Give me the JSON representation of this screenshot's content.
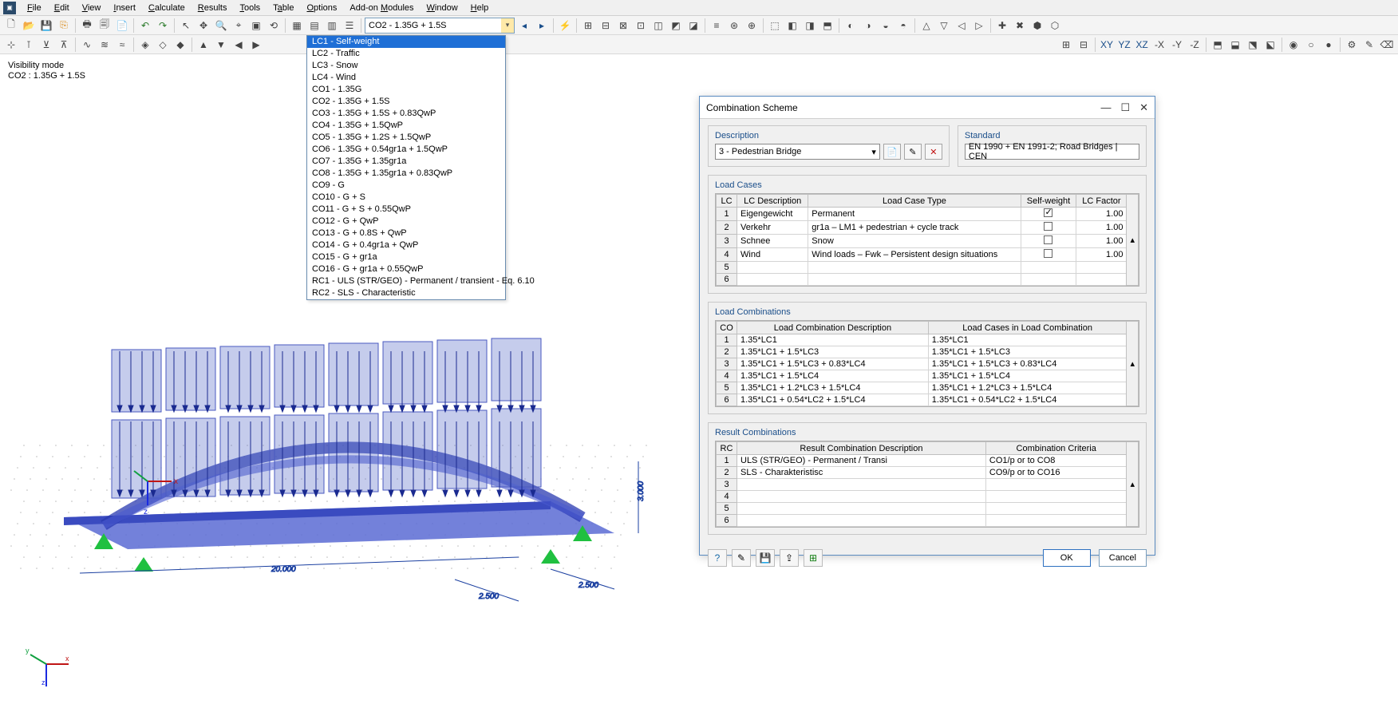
{
  "menu": {
    "items": [
      "File",
      "Edit",
      "View",
      "Insert",
      "Calculate",
      "Results",
      "Tools",
      "Table",
      "Options",
      "Add-on Modules",
      "Window",
      "Help"
    ]
  },
  "combo": {
    "value": "CO2 - 1.35G + 1.5S"
  },
  "dropdown": {
    "selected": 0,
    "options": [
      "LC1 - Self-weight",
      "LC2 - Traffic",
      "LC3 - Snow",
      "LC4 - Wind",
      "CO1 - 1.35G",
      "CO2 - 1.35G + 1.5S",
      "CO3 - 1.35G + 1.5S + 0.83QwP",
      "CO4 - 1.35G + 1.5QwP",
      "CO5 - 1.35G + 1.2S + 1.5QwP",
      "CO6 - 1.35G + 0.54gr1a + 1.5QwP",
      "CO7 - 1.35G + 1.35gr1a",
      "CO8 - 1.35G + 1.35gr1a + 0.83QwP",
      "CO9 - G",
      "CO10 - G + S",
      "CO11 - G + S + 0.55QwP",
      "CO12 - G + QwP",
      "CO13 - G + 0.8S + QwP",
      "CO14 - G + 0.4gr1a + QwP",
      "CO15 - G + gr1a",
      "CO16 - G + gr1a + 0.55QwP",
      "RC1 - ULS (STR/GEO) - Permanent / transient - Eq. 6.10",
      "RC2 - SLS - Characteristic"
    ]
  },
  "viewport": {
    "line1": "Visibility mode",
    "line2": "CO2 : 1.35G + 1.5S",
    "dim_length": "20.000",
    "dim_width": "2.500",
    "dim_height": "3.000"
  },
  "dialog": {
    "title": "Combination Scheme",
    "description_label": "Description",
    "description_value": "3 - Pedestrian Bridge",
    "standard_label": "Standard",
    "standard_value": "EN 1990 + EN 1991-2; Road Bridges | CEN",
    "load_cases": {
      "title": "Load Cases",
      "headers": [
        "LC",
        "LC Description",
        "Load Case Type",
        "Self-weight",
        "LC Factor"
      ],
      "rows": [
        {
          "n": "1",
          "desc": "Eigengewicht",
          "type": "Permanent",
          "sw": true,
          "f": "1.00"
        },
        {
          "n": "2",
          "desc": "Verkehr",
          "type": "gr1a – LM1 + pedestrian + cycle track",
          "sw": false,
          "f": "1.00"
        },
        {
          "n": "3",
          "desc": "Schnee",
          "type": "Snow",
          "sw": false,
          "f": "1.00"
        },
        {
          "n": "4",
          "desc": "Wind",
          "type": "Wind loads – Fwk – Persistent design situations",
          "sw": false,
          "f": "1.00"
        },
        {
          "n": "5",
          "desc": "",
          "type": "",
          "sw": null,
          "f": ""
        },
        {
          "n": "6",
          "desc": "",
          "type": "",
          "sw": null,
          "f": ""
        }
      ]
    },
    "load_combos": {
      "title": "Load Combinations",
      "headers": [
        "CO",
        "Load Combination Description",
        "Load Cases in Load Combination"
      ],
      "rows": [
        {
          "n": "1",
          "d": "1.35*LC1",
          "c": "1.35*LC1"
        },
        {
          "n": "2",
          "d": "1.35*LC1 + 1.5*LC3",
          "c": "1.35*LC1 + 1.5*LC3"
        },
        {
          "n": "3",
          "d": "1.35*LC1 + 1.5*LC3 + 0.83*LC4",
          "c": "1.35*LC1 + 1.5*LC3 + 0.83*LC4"
        },
        {
          "n": "4",
          "d": "1.35*LC1 + 1.5*LC4",
          "c": "1.35*LC1 + 1.5*LC4"
        },
        {
          "n": "5",
          "d": "1.35*LC1 + 1.2*LC3 + 1.5*LC4",
          "c": "1.35*LC1 + 1.2*LC3 + 1.5*LC4"
        },
        {
          "n": "6",
          "d": "1.35*LC1 + 0.54*LC2 + 1.5*LC4",
          "c": "1.35*LC1 + 0.54*LC2 + 1.5*LC4"
        }
      ]
    },
    "result_combos": {
      "title": "Result Combinations",
      "headers": [
        "RC",
        "Result Combination Description",
        "Combination Criteria"
      ],
      "rows": [
        {
          "n": "1",
          "d": "ULS (STR/GEO) - Permanent / Transi",
          "c": "CO1/p or to CO8"
        },
        {
          "n": "2",
          "d": "SLS - Charakteristisc",
          "c": "CO9/p or to CO16"
        },
        {
          "n": "3",
          "d": "",
          "c": ""
        },
        {
          "n": "4",
          "d": "",
          "c": ""
        },
        {
          "n": "5",
          "d": "",
          "c": ""
        },
        {
          "n": "6",
          "d": "",
          "c": ""
        }
      ]
    },
    "buttons": {
      "ok": "OK",
      "cancel": "Cancel"
    }
  }
}
